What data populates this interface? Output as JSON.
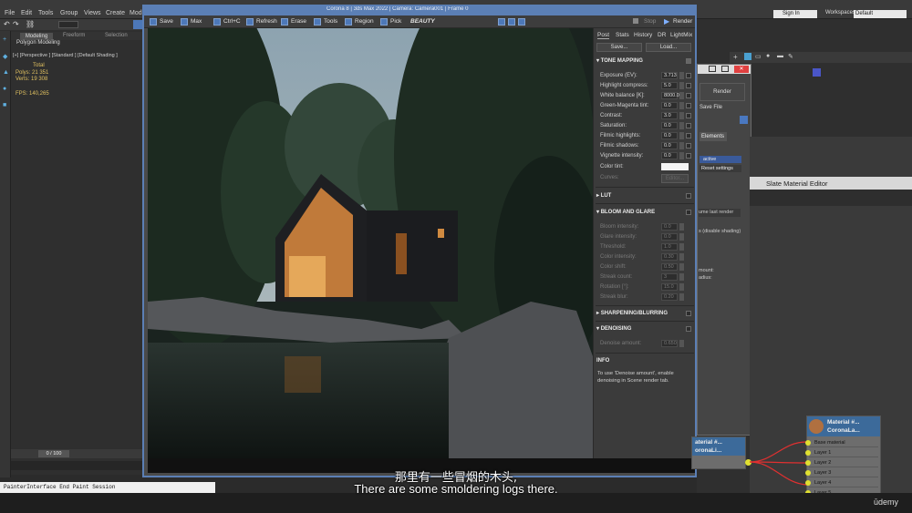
{
  "menubar": {
    "items": [
      "File",
      "Edit",
      "Tools",
      "Group",
      "Views",
      "Create",
      "Modi"
    ],
    "sign_in": "Sign In",
    "workspace_label": "Workspaces:",
    "workspace_value": "Default"
  },
  "viewport": {
    "ribbon_tabs": [
      "Modeling",
      "Freeform",
      "Selection"
    ],
    "ribbon_sub": "Polygon Modeling",
    "label": "[+] [Perspective ] [Standard ] [Default Shading ]",
    "stats": {
      "total": "Total",
      "polys": "Polys:  21 351",
      "verts": "Verts:  19 308",
      "fps": "FPS:   140,265"
    }
  },
  "framebuffer": {
    "title": "Corona 8 | 3ds Max 2022 | Camera: Camera001 | Frame 0",
    "toolbar": [
      "Save",
      "Max",
      "Ctrl+C",
      "Refresh",
      "Erase",
      "Tools",
      "Region",
      "Pick"
    ],
    "beauty": "BEAUTY",
    "stop": "Stop",
    "render": "Render",
    "tabs": [
      "Post",
      "Stats",
      "History",
      "DR",
      "LightMix"
    ],
    "save_btn": "Save...",
    "load_btn": "Load...",
    "sections": {
      "tone": "TONE MAPPING",
      "lut": "LUT",
      "bloom": "BLOOM AND GLARE",
      "sharpen": "SHARPENING/BLURRING",
      "denoise": "DENOISING",
      "info": "INFO"
    },
    "tone_rows": [
      {
        "label": "Exposure (EV):",
        "value": "3.713"
      },
      {
        "label": "Highlight compress:",
        "value": "5.0"
      },
      {
        "label": "White balance [K]:",
        "value": "8000.0"
      },
      {
        "label": "Green-Magenta tint:",
        "value": "0.0"
      },
      {
        "label": "Contrast:",
        "value": "3.0"
      },
      {
        "label": "Saturation:",
        "value": "0.0"
      },
      {
        "label": "Filmic highlights:",
        "value": "0.0"
      },
      {
        "label": "Filmic shadows:",
        "value": "0.0"
      },
      {
        "label": "Vignette intensity:",
        "value": "0.0"
      }
    ],
    "color_tint": "Color tint:",
    "curves": "Curves:",
    "curves_btn": "Editor...",
    "bloom_rows": [
      {
        "label": "Bloom intensity:",
        "value": "0.0"
      },
      {
        "label": "Glare intensity:",
        "value": "0.0"
      },
      {
        "label": "Threshold:",
        "value": "1.0"
      },
      {
        "label": "Color intensity:",
        "value": "0.30"
      },
      {
        "label": "Color shift:",
        "value": "0.50"
      },
      {
        "label": "Streak count:",
        "value": "3"
      },
      {
        "label": "Rotation [°]:",
        "value": "15.0"
      },
      {
        "label": "Streak blur:",
        "value": "0.20"
      }
    ],
    "denoise_row": {
      "label": "Denoise amount:",
      "value": "0.650"
    },
    "info_text": "To use 'Denoise amount', enable denoising in Scene render tab."
  },
  "render_setup": {
    "render_btn": "Render",
    "save_file": "Save File",
    "elements": "Elements",
    "interactive": "active",
    "reset": "Reset settings",
    "lock_label": "ume last render",
    "disable_shading": "s (disable shading)",
    "amount": "mount:",
    "radius": "adius:"
  },
  "slate": {
    "title": "Slate Material Editor",
    "node_left_title": "aterial #...",
    "node_left_sub": "oronaLi...",
    "node_title": "Material #...",
    "node_sub": "CoronaLa...",
    "layers": [
      "Base material",
      "Layer 1",
      "Layer 2",
      "Layer 3",
      "Layer 4",
      "Layer 5"
    ]
  },
  "timeline": {
    "frame": "0 / 100"
  },
  "script_line": "PainterInterface End Paint Session",
  "subtitles": {
    "cn": "那里有一些冒烟的木头,",
    "en": "There are some smoldering logs there."
  },
  "watermark": "ūdemy",
  "colors": {
    "accent": "#5b7fb5",
    "socket": "#e0e030",
    "node_header": "#3c6a9a"
  }
}
